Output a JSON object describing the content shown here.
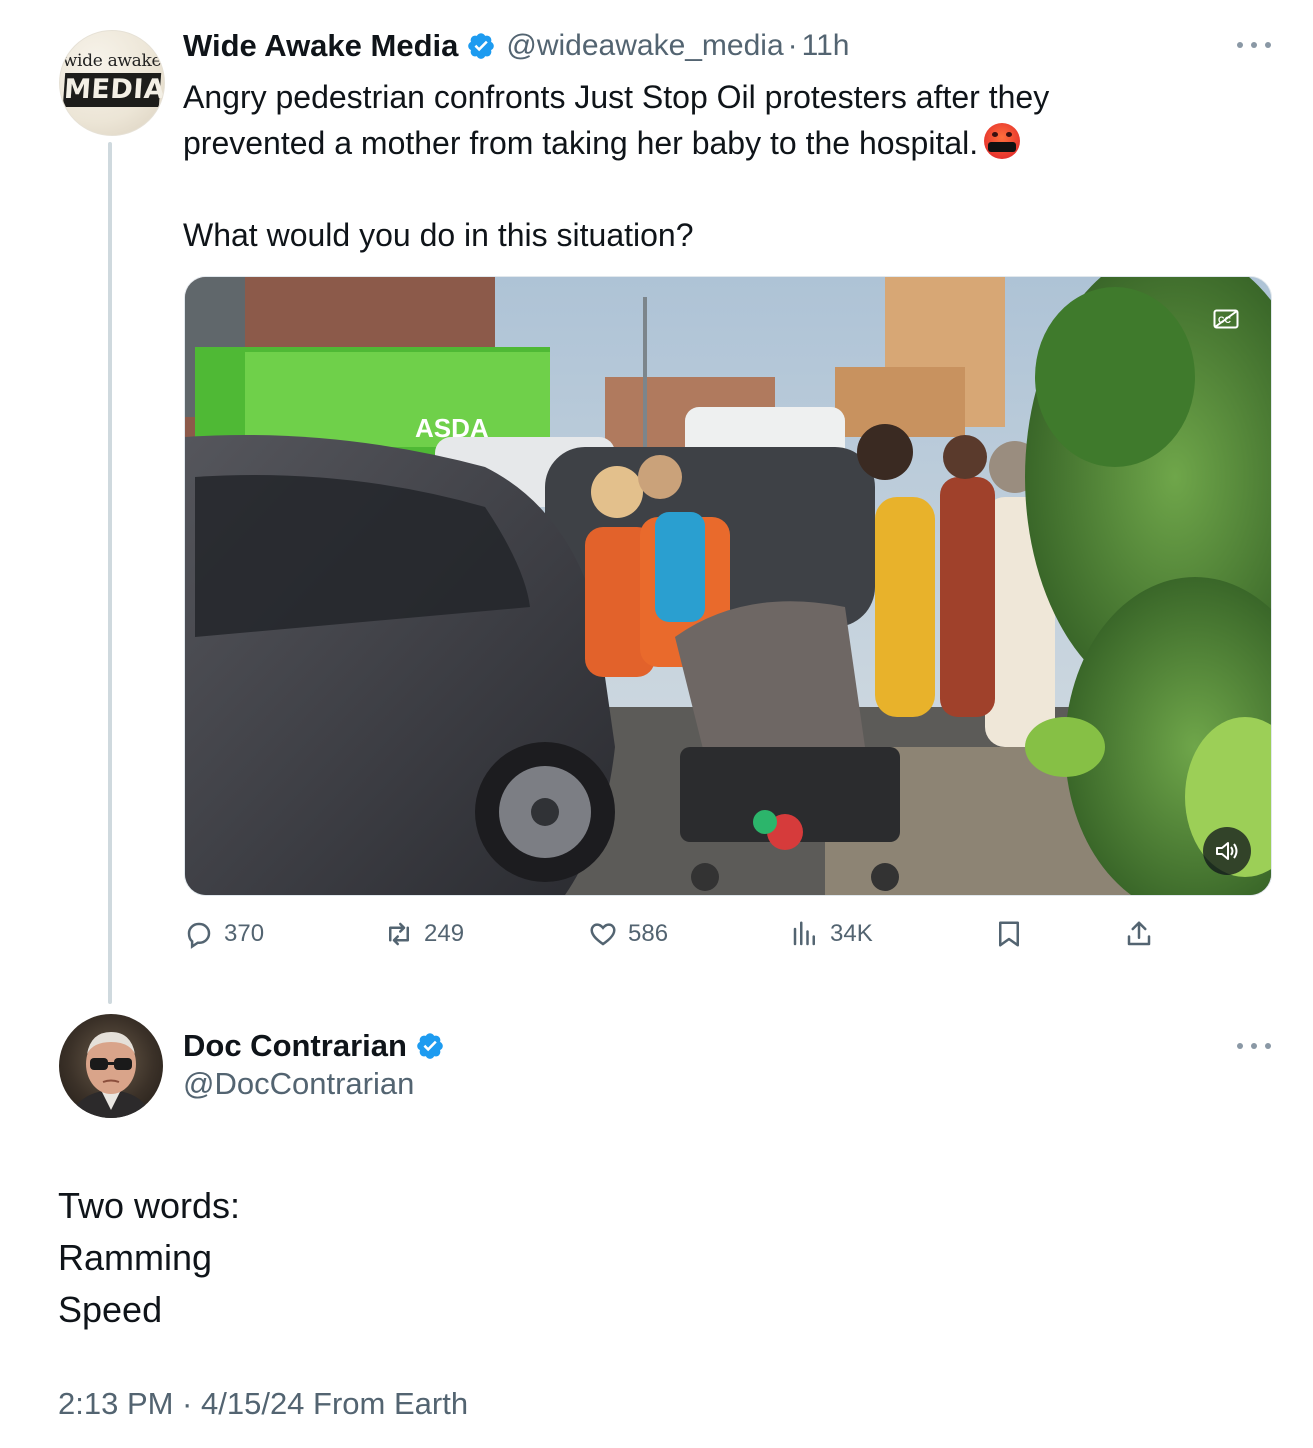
{
  "original_tweet": {
    "author_name": "Wide Awake Media",
    "handle": "@wideawake_media",
    "separator": "·",
    "time": "11h",
    "avatar_text_top": "wide awake",
    "avatar_text_bottom": "MEDIA",
    "text_line1": "Angry pedestrian confronts Just Stop Oil protesters after they",
    "text_line2": "prevented a mother from taking her baby to the hospital.",
    "emoji": "face-with-symbols-on-mouth-emoji",
    "text_para2": "What would you do in this situation?",
    "video_sign_text": "ASDA",
    "actions": {
      "replies": "370",
      "reposts": "249",
      "likes": "586",
      "views": "34K"
    }
  },
  "reply": {
    "author_name": "Doc Contrarian",
    "handle": "@DocContrarian",
    "lines": [
      "Two words:",
      "Ramming",
      "Speed"
    ],
    "timestamp": "2:13 PM · 4/15/24 From Earth"
  },
  "colors": {
    "text_primary": "#0f1419",
    "text_secondary": "#536471",
    "verified_blue": "#1d9bf0",
    "thread_line": "#cfd9de"
  },
  "icons": [
    "verified-badge-icon",
    "more-icon",
    "cc-icon",
    "sound-icon",
    "reply-icon",
    "repost-icon",
    "like-icon",
    "views-icon",
    "bookmark-icon",
    "share-icon"
  ]
}
